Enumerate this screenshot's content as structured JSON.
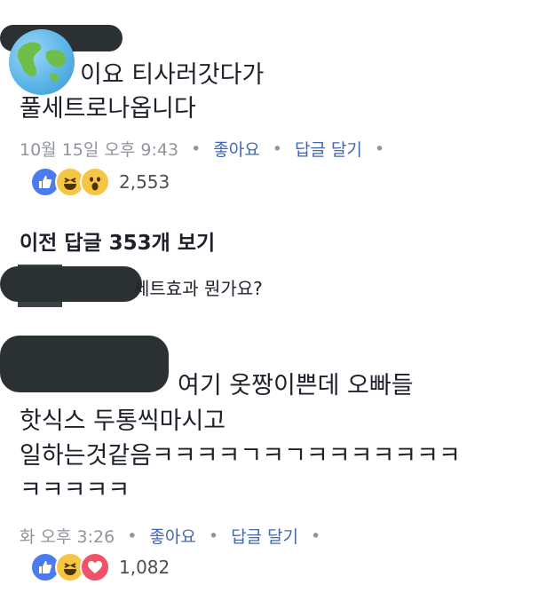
{
  "comment1": {
    "lines": [
      "이요 티사러갓다가",
      "풀세트로나옵니다"
    ],
    "time": "10월 15일 오후 9:43",
    "like": "좋아요",
    "reply": "답글 달기",
    "reaction_icons": [
      "like-icon",
      "haha-icon",
      "wow-icon"
    ],
    "reaction_count": "2,553"
  },
  "previous_replies": "이전 답글 353개 보기",
  "reply_preview": {
    "text": "세트효과 뭔가요?"
  },
  "comment2": {
    "lines": [
      "여기 옷짱이쁜데 오빠들",
      "핫식스 두통씩마시고",
      "일하는것같음ㅋㅋㅋㅋㄱㅋㄱㅋㅋㅋㅋㅋㅋㅋ",
      "ㅋㅋㅋㅋㅋ"
    ],
    "time": "화 오후 3:26",
    "like": "좋아요",
    "reply": "답글 달기",
    "reaction_icons": [
      "like-icon",
      "haha-icon",
      "love-icon"
    ],
    "reaction_count": "1,082"
  },
  "colors": {
    "link": "#4267b2",
    "meta": "#90949c",
    "like": "#4a7cf0",
    "haha": "#f7c544",
    "love": "#f25268",
    "redaction": "#2b3033"
  },
  "separator": "•"
}
